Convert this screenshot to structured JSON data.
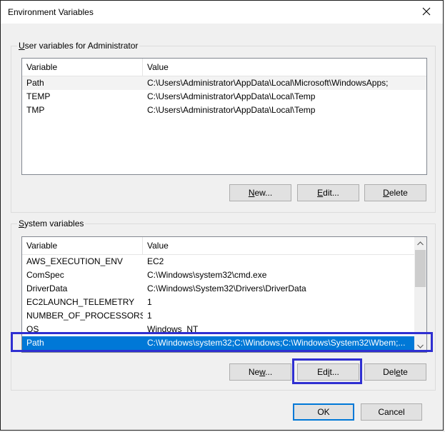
{
  "window": {
    "title": "Environment Variables",
    "close_icon": "close-icon"
  },
  "user_vars": {
    "group_label_prefix": "U",
    "group_label_rest": "ser variables for Administrator",
    "columns": [
      "Variable",
      "Value"
    ],
    "rows": [
      {
        "name": "Path",
        "value": "C:\\Users\\Administrator\\AppData\\Local\\Microsoft\\WindowsApps;"
      },
      {
        "name": "TEMP",
        "value": "C:\\Users\\Administrator\\AppData\\Local\\Temp"
      },
      {
        "name": "TMP",
        "value": "C:\\Users\\Administrator\\AppData\\Local\\Temp"
      }
    ],
    "buttons": {
      "new_u": "N",
      "new_rest": "ew...",
      "edit_u": "E",
      "edit_rest": "dit...",
      "delete_u": "D",
      "delete_rest": "elete"
    }
  },
  "system_vars": {
    "group_label_prefix": "S",
    "group_label_rest": "ystem variables",
    "columns": [
      "Variable",
      "Value"
    ],
    "rows": [
      {
        "name": "AWS_EXECUTION_ENV",
        "value": "EC2"
      },
      {
        "name": "ComSpec",
        "value": "C:\\Windows\\system32\\cmd.exe"
      },
      {
        "name": "DriverData",
        "value": "C:\\Windows\\System32\\Drivers\\DriverData"
      },
      {
        "name": "EC2LAUNCH_TELEMETRY",
        "value": "1"
      },
      {
        "name": "NUMBER_OF_PROCESSORS",
        "value": "1"
      },
      {
        "name": "OS",
        "value": "Windows_NT"
      },
      {
        "name": "Path",
        "value": "C:\\Windows\\system32;C:\\Windows;C:\\Windows\\System32\\Wbem;..."
      }
    ],
    "buttons": {
      "new_pre": "Ne",
      "new_u": "w",
      "new_rest": "...",
      "edit_pre": "Ed",
      "edit_u": "i",
      "edit_rest": "t...",
      "delete_pre": "Del",
      "delete_u": "e",
      "delete_rest": "te"
    }
  },
  "footer": {
    "ok_label": "OK",
    "cancel_label": "Cancel"
  }
}
